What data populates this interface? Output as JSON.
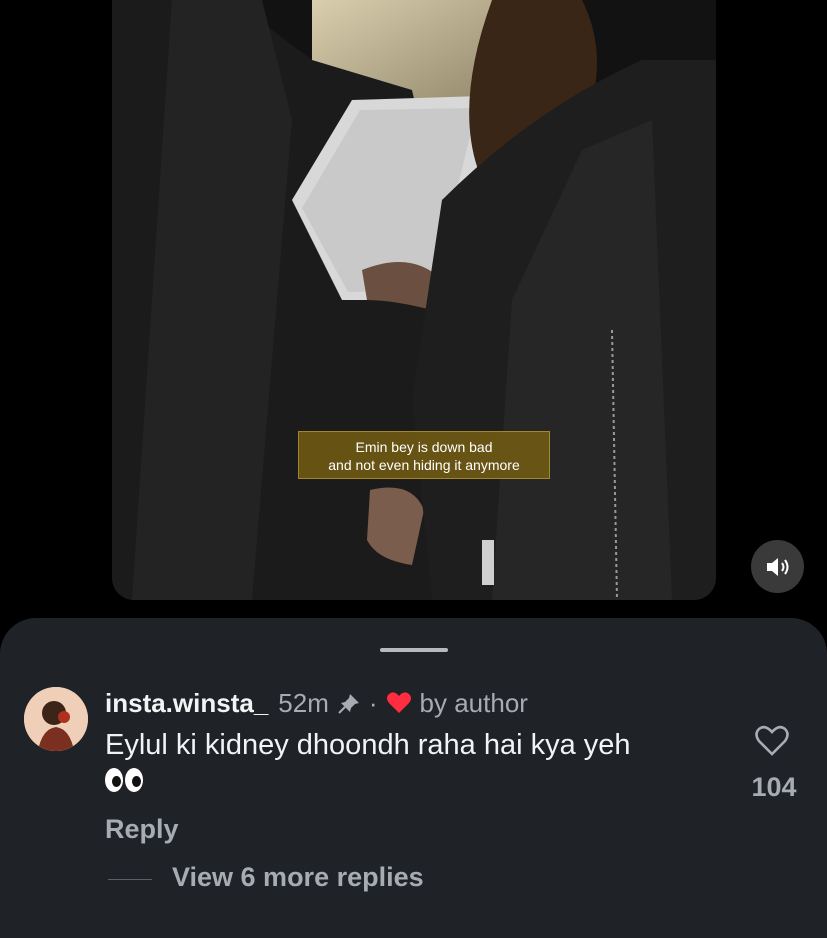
{
  "video": {
    "subtitle_line1": "Emin bey is down bad",
    "subtitle_line2": "and not even hiding it anymore",
    "mute_icon": "speaker-icon"
  },
  "comment": {
    "username": "insta.winsta_",
    "time": "52m",
    "pinned_icon": "pin-icon",
    "separator": "·",
    "liked_icon": "red-heart-icon",
    "liked_by": "by author",
    "text": "Eylul ki kidney dhoondh raha hai kya yeh",
    "emoji": "eyes-emoji",
    "like_count": "104",
    "reply_label": "Reply",
    "view_replies_label": "View 6 more replies"
  },
  "colors": {
    "sheet_bg": "#1f2227",
    "accent_red": "#ff2d3f",
    "muted_text": "#a7abb2",
    "primary_text": "#f2f3f5"
  }
}
